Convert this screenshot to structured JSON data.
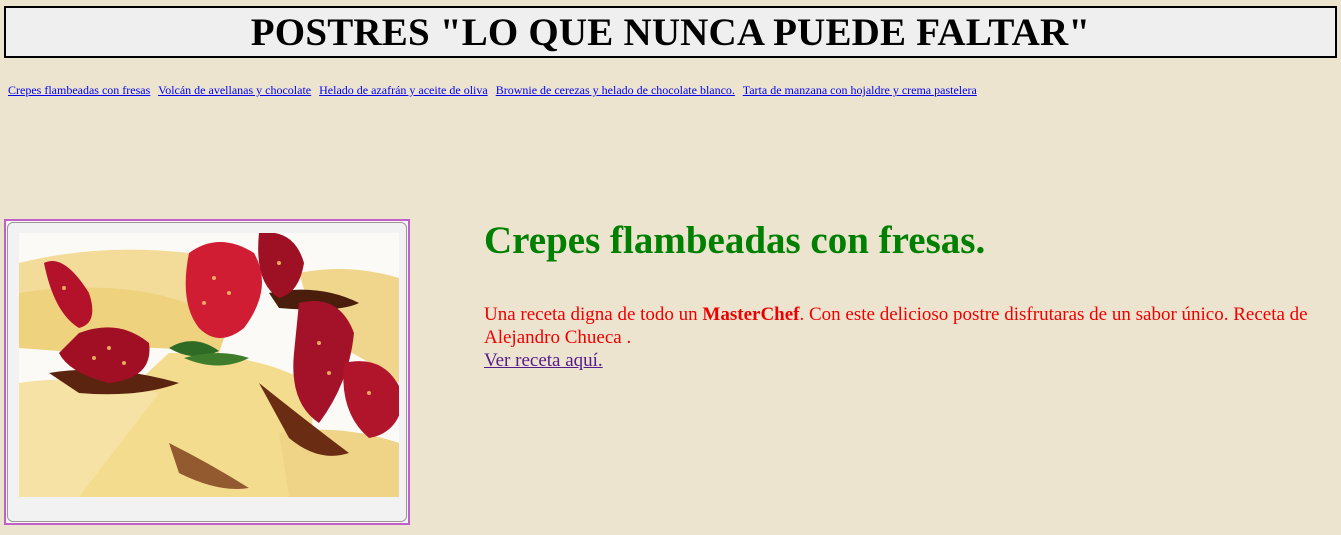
{
  "header": {
    "title": "POSTRES \"LO QUE NUNCA PUEDE FALTAR\""
  },
  "nav": {
    "links": [
      "Crepes flambeadas con fresas",
      "Volcán de avellanas y chocolate",
      "Helado de azafrán y aceite de oliva",
      "Brownie de cerezas y helado de chocolate blanco.",
      "Tarta de manzana con hojaldre y crema pastelera"
    ]
  },
  "main": {
    "image_icon": "crepes-with-strawberries-photo",
    "title": "Crepes flambeadas con fresas.",
    "description_before": "Una receta digna de todo un ",
    "description_bold": "MasterChef",
    "description_after": ". Con este delicioso postre disfrutaras de un sabor único. Receta de Alejandro Chueca .",
    "link_label": "Ver receta aquí."
  },
  "colors": {
    "background": "#ede4d0",
    "title_green": "#008000",
    "text_red": "#ee0000",
    "link_blue": "#0000ee",
    "visited_link": "#551a8b",
    "frame_border": "#c060c8"
  }
}
